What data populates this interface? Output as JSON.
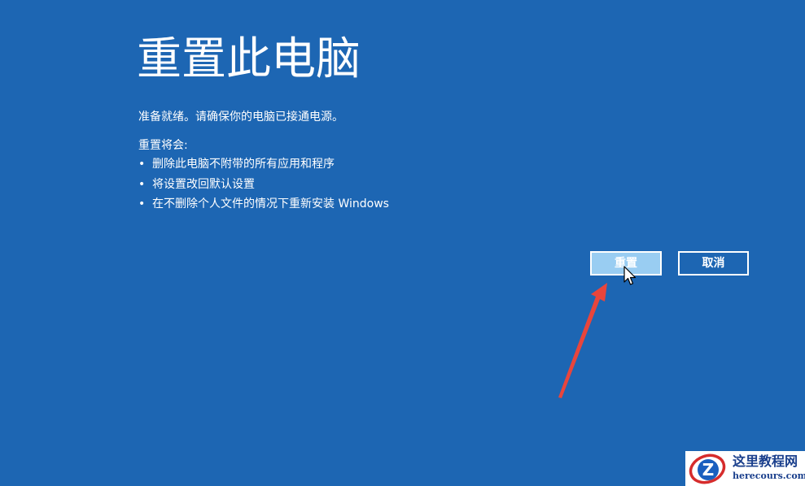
{
  "page": {
    "title": "重置此电脑",
    "ready_text": "准备就绪。请确保你的电脑已接通电源。",
    "reset_will_label": "重置将会:",
    "bullet_symbol": "•",
    "bullets": [
      "删除此电脑不附带的所有应用和程序",
      "将设置改回默认设置",
      "在不删除个人文件的情况下重新安装 Windows"
    ]
  },
  "buttons": {
    "reset_label": "重置",
    "cancel_label": "取消"
  },
  "watermark": {
    "name": "这里教程网",
    "url": "herecours.com",
    "logo_letter": "Z"
  },
  "colors": {
    "background": "#1d66b3",
    "reset_button_bg": "#99cdf2",
    "annotation_arrow": "#e8453c",
    "watermark_text": "#1a3f8c"
  },
  "icons": {
    "cursor": "mouse-pointer-icon",
    "arrow": "red-annotation-arrow"
  }
}
